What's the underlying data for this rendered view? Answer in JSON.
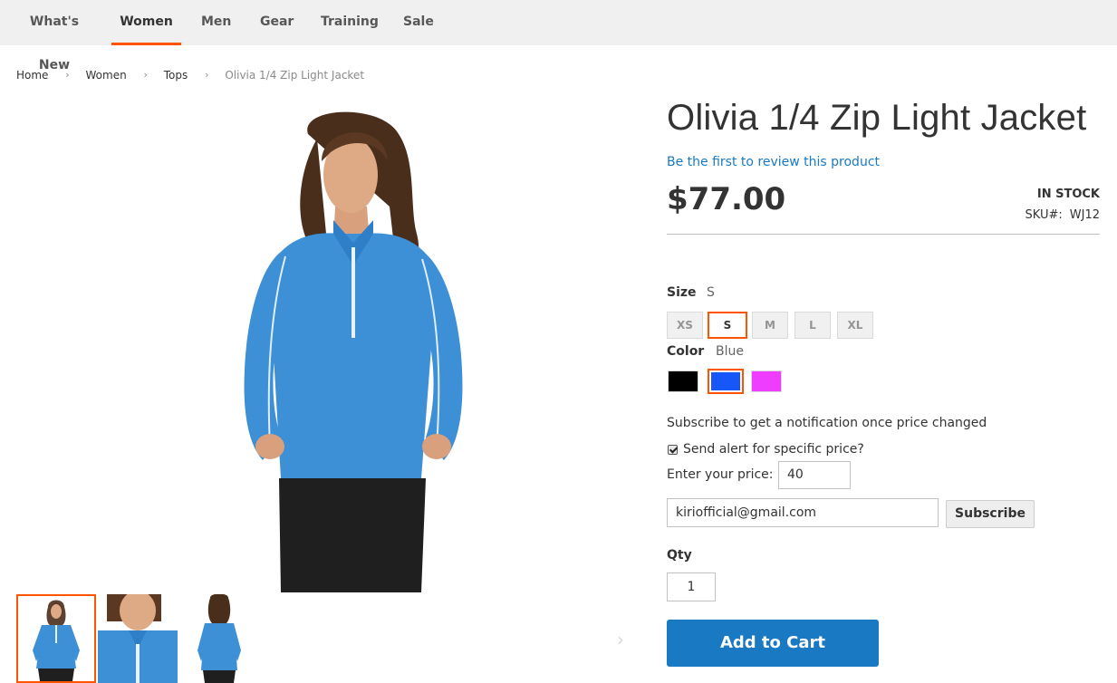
{
  "nav": {
    "items": [
      {
        "label": "What's New",
        "active": false
      },
      {
        "label": "Women",
        "active": true
      },
      {
        "label": "Men",
        "active": false
      },
      {
        "label": "Gear",
        "active": false
      },
      {
        "label": "Training",
        "active": false
      },
      {
        "label": "Sale",
        "active": false
      }
    ]
  },
  "breadcrumb": {
    "items": [
      "Home",
      "Women",
      "Tops",
      "Olivia 1/4 Zip Light Jacket"
    ],
    "separator": "›"
  },
  "product": {
    "title": "Olivia 1/4 Zip Light Jacket",
    "review_link": "Be the first to review this product",
    "price": "$77.00",
    "stock": "IN STOCK",
    "sku_label": "SKU#:",
    "sku": "WJ12"
  },
  "options": {
    "size_label": "Size",
    "size_selected": "S",
    "sizes": [
      "XS",
      "S",
      "M",
      "L",
      "XL"
    ],
    "color_label": "Color",
    "color_selected": "Blue",
    "colors": [
      {
        "name": "Black",
        "hex": "#000000"
      },
      {
        "name": "Blue",
        "hex": "#1857f7"
      },
      {
        "name": "Purple",
        "hex": "#ef3dff"
      }
    ]
  },
  "price_alert": {
    "heading": "Subscribe to get a notification once price changed",
    "checkbox_label": "Send alert for specific price?",
    "checkbox_checked": true,
    "price_label": "Enter your price: $",
    "price_value": "40",
    "email_value": "kiriofficial@gmail.com",
    "subscribe_label": "Subscribe"
  },
  "cart": {
    "qty_label": "Qty",
    "qty_value": "1",
    "add_to_cart_label": "Add to Cart"
  },
  "gallery": {
    "next_arrow": "›"
  },
  "colors": {
    "accent": "#ff5501",
    "primary_button": "#1979c3",
    "link": "#1979c3",
    "jacket": "#3d8fd6"
  }
}
